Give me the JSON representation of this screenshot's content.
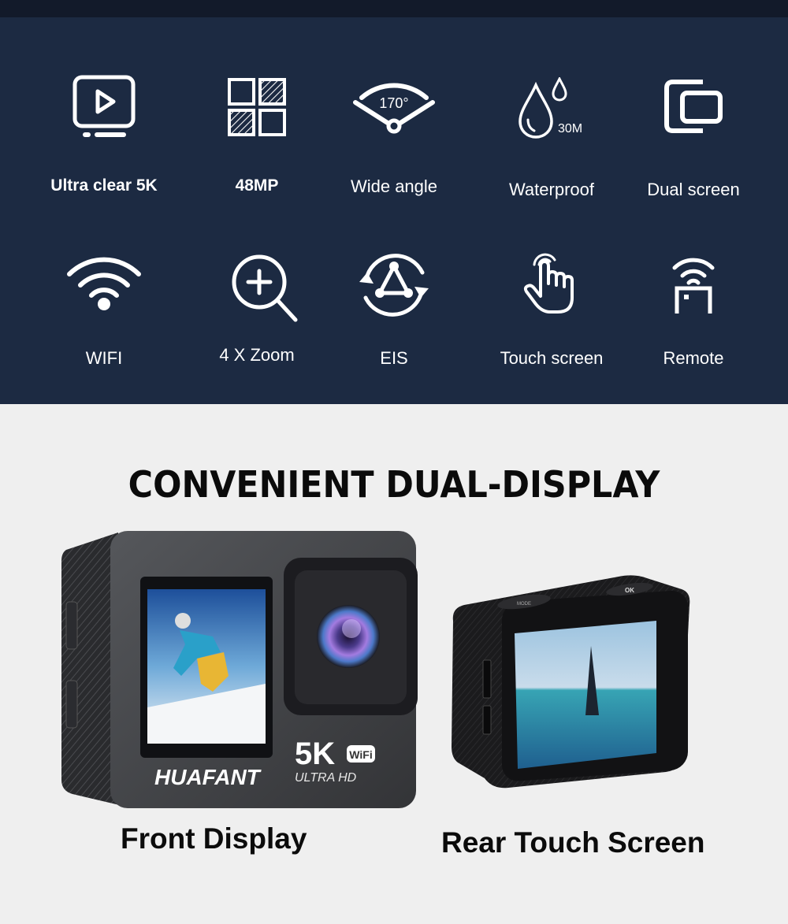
{
  "features": [
    {
      "label": "Ultra clear 5K",
      "icon": "play-screen-icon",
      "bold": true
    },
    {
      "label": "48MP",
      "icon": "pixel-grid-icon",
      "bold": true
    },
    {
      "label": "Wide angle",
      "icon": "wide-angle-icon",
      "icon_text": "170°",
      "bold": false
    },
    {
      "label": "Waterproof",
      "icon": "water-drop-icon",
      "icon_text": "30M",
      "bold": false
    },
    {
      "label": "Dual screen",
      "icon": "dual-screen-icon",
      "bold": false
    },
    {
      "label": "WIFI",
      "icon": "wifi-icon",
      "bold": false
    },
    {
      "label": "4 X Zoom",
      "icon": "zoom-in-icon",
      "bold": false
    },
    {
      "label": "EIS",
      "icon": "stabilization-icon",
      "bold": false
    },
    {
      "label": "Touch screen",
      "icon": "touch-hand-icon",
      "bold": false
    },
    {
      "label": "Remote",
      "icon": "remote-icon",
      "bold": false
    }
  ],
  "headline": "CONVENIENT DUAL-DISPLAY",
  "front_camera": {
    "brand": "HUAFANT",
    "badge": "5K",
    "wifi_badge": "WiFi",
    "subtitle": "ULTRA HD",
    "caption": "Front Display"
  },
  "rear_camera": {
    "button_left": "MODE",
    "button_right": "OK",
    "caption": "Rear Touch Screen"
  },
  "colors": {
    "panel_bg": "#1c2a42",
    "topbar_bg": "#121a2a",
    "page_bg": "#efefef",
    "text_dark": "#0b0b0b"
  }
}
